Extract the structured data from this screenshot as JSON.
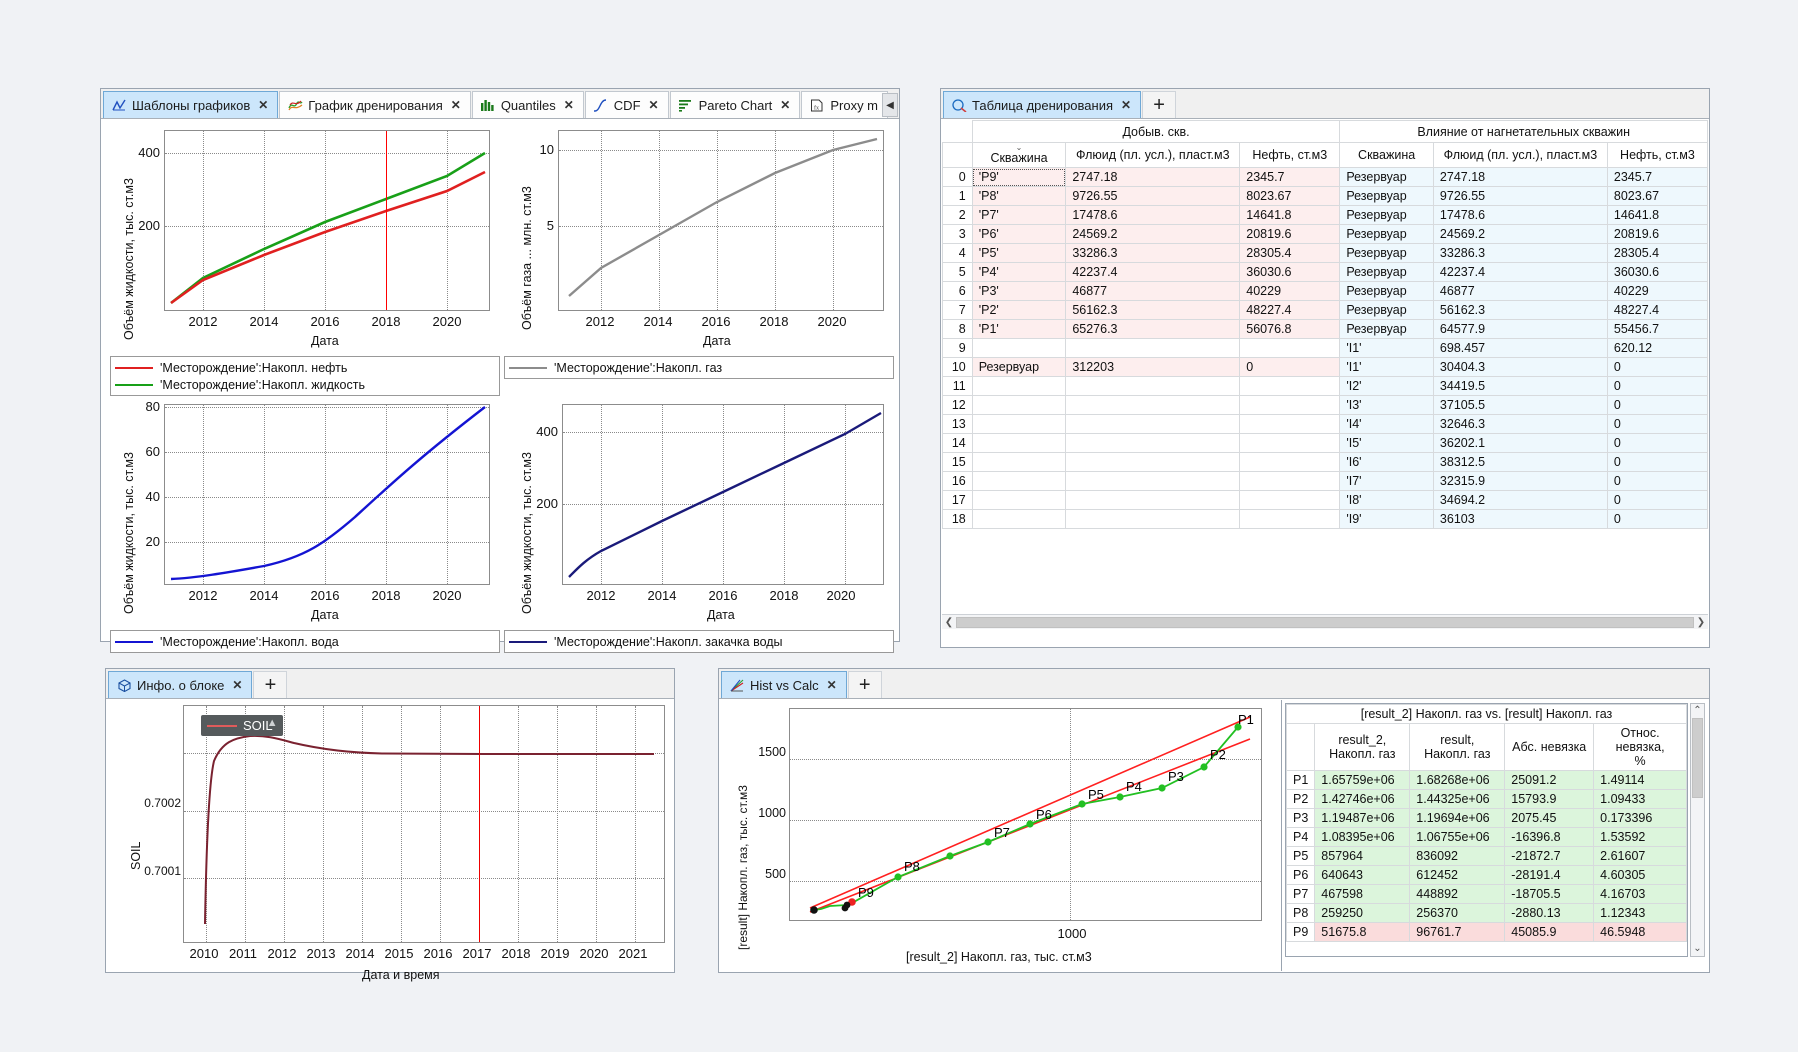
{
  "app": {
    "background": "#f0f2f5",
    "accent": "#cce6fb"
  },
  "panel_charts": {
    "tabs": [
      {
        "label": "Шаблоны графиков",
        "icon": "chart-curve-icon",
        "active": true,
        "close": "✕"
      },
      {
        "label": "График дренирования",
        "icon": "squiggle-icon",
        "active": false,
        "close": "✕"
      },
      {
        "label": "Quantiles",
        "icon": "histogram-icon",
        "active": false,
        "close": "✕"
      },
      {
        "label": "CDF",
        "icon": "cdf-curve-icon",
        "active": false,
        "close": "✕"
      },
      {
        "label": "Pareto Chart",
        "icon": "pareto-bars-icon",
        "active": false,
        "close": "✕"
      },
      {
        "label": "Proxy m",
        "icon": "formula-icon",
        "active": false,
        "close": ""
      }
    ],
    "scroll_right": "◀"
  },
  "chart_data": [
    {
      "id": "liquid-oil",
      "type": "line",
      "title": "",
      "xlabel": "Дата",
      "ylabel": "Объём жидкости, тыс. ст.м3",
      "xticks": [
        "2012",
        "2014",
        "2016",
        "2018",
        "2020"
      ],
      "yticks": [
        "200",
        "400"
      ],
      "ylim": [
        0,
        460
      ],
      "xlim": [
        2010.3,
        2021.0
      ],
      "grid": true,
      "cursor_x": 2017.75,
      "cursor_color": "#ff0000",
      "series": [
        {
          "name": "'Месторождение':Накопл. нефть",
          "color": "#e02020",
          "x": [
            2010.4,
            2012,
            2014,
            2016,
            2018,
            2020.8
          ],
          "values": [
            8,
            70,
            140,
            200,
            252,
            357
          ]
        },
        {
          "name": "'Месторождение':Накопл. жидкость",
          "color": "#18a018",
          "x": [
            2010.4,
            2012,
            2014,
            2016,
            2018,
            2020.8
          ],
          "values": [
            8,
            72,
            150,
            226,
            305,
            438
          ]
        }
      ],
      "legend_position": "bottom"
    },
    {
      "id": "gas",
      "type": "line",
      "xlabel": "Дата",
      "ylabel": "Объём газа ... млн. ст.м3",
      "xticks": [
        "2012",
        "2014",
        "2016",
        "2018",
        "2020"
      ],
      "yticks": [
        "5",
        "10"
      ],
      "ylim": [
        0,
        11.2
      ],
      "xlim": [
        2010.3,
        2021.0
      ],
      "grid": true,
      "series": [
        {
          "name": "'Месторождение':Накопл. газ",
          "color": "#8c8c8c",
          "x": [
            2010.4,
            2012,
            2014,
            2016,
            2018,
            2020.8
          ],
          "values": [
            0.6,
            2.6,
            4.4,
            6.4,
            8.2,
            10.7
          ]
        }
      ],
      "legend_position": "bottom"
    },
    {
      "id": "water",
      "type": "line",
      "xlabel": "Дата",
      "ylabel": "Объём жидкости, тыс. ст.м3",
      "xticks": [
        "2012",
        "2014",
        "2016",
        "2018",
        "2020"
      ],
      "yticks": [
        "20",
        "40",
        "60",
        "80"
      ],
      "ylim": [
        0,
        84
      ],
      "xlim": [
        2010.3,
        2021.0
      ],
      "grid": true,
      "series": [
        {
          "name": "'Месторождение':Накопл. вода",
          "color": "#1414d2",
          "x": [
            2010.4,
            2012,
            2014,
            2016,
            2018,
            2020.8
          ],
          "values": [
            1.5,
            4,
            10,
            22,
            42,
            81
          ]
        }
      ],
      "legend_position": "bottom"
    },
    {
      "id": "water-inj",
      "type": "line",
      "xlabel": "Дата",
      "ylabel": "Объём жидкости, тыс. ст.м3",
      "xticks": [
        "2012",
        "2014",
        "2016",
        "2018",
        "2020"
      ],
      "yticks": [
        "200",
        "400"
      ],
      "ylim": [
        0,
        500
      ],
      "xlim": [
        2010.3,
        2021.0
      ],
      "grid": true,
      "series": [
        {
          "name": "'Месторождение':Накопл. закачка воды",
          "color": "#1a1a7a",
          "x": [
            2010.4,
            2012,
            2014,
            2016,
            2018,
            2020.8
          ],
          "values": [
            8,
            100,
            190,
            280,
            370,
            480
          ]
        }
      ],
      "legend_position": "bottom"
    },
    {
      "id": "soil",
      "type": "line",
      "xlabel": "Дата и время",
      "ylabel": "SOIL",
      "xticks": [
        "2010",
        "2011",
        "2012",
        "2013",
        "2014",
        "2015",
        "2016",
        "2017",
        "2018",
        "2019",
        "2020",
        "2021"
      ],
      "yticks": [
        "0.7001",
        "0.7002"
      ],
      "grid": true,
      "cursor_x": 2017.75,
      "cursor_color": "#ff0000",
      "legend_overlay": "SOIL",
      "series": [
        {
          "name": "SOIL",
          "color": "#7a2230",
          "x": [
            2010.0,
            2010.1,
            2010.25,
            2010.5,
            2011.0,
            2011.5,
            2012.0,
            2013.0,
            2014.0,
            2015.0,
            2017.0,
            2019.0,
            2021.0
          ],
          "values": [
            0.7,
            0.70015,
            0.70025,
            0.70029,
            0.70031,
            0.700315,
            0.70031,
            0.700305,
            0.7003,
            0.700298,
            0.700297,
            0.700297,
            0.700297
          ]
        }
      ]
    },
    {
      "id": "hist-vs-calc",
      "type": "scatter",
      "xlabel": "[result_2] Накопл. газ, тыс. ст.м3",
      "ylabel": "[result] Накопл. газ, тыс. ст.м3",
      "xticks": [
        "1000"
      ],
      "yticks": [
        "500",
        "1000",
        "1500"
      ],
      "grid": true,
      "points": [
        {
          "label": "P1",
          "x": 1657.59,
          "y": 1682.68
        },
        {
          "label": "P2",
          "x": 1427.46,
          "y": 1443.25
        },
        {
          "label": "P3",
          "x": 1194.87,
          "y": 1196.94
        },
        {
          "label": "P4",
          "x": 1083.95,
          "y": 1067.55
        },
        {
          "label": "P5",
          "x": 857.96,
          "y": 836.09
        },
        {
          "label": "P6",
          "x": 640.64,
          "y": 612.45
        },
        {
          "label": "P7",
          "x": 467.6,
          "y": 448.89
        },
        {
          "label": "P8",
          "x": 259.25,
          "y": 256.37
        },
        {
          "label": "P9",
          "x": 51.68,
          "y": 96.76
        }
      ],
      "point_color": "#22c022",
      "tolerance_lines_color": "#ff2020"
    }
  ],
  "panel_drainage_table": {
    "tabs": [
      {
        "label": "Таблица дренирования",
        "icon": "table-icon",
        "active": true,
        "close": "✕"
      }
    ],
    "add_tab": "✛",
    "group_headers": [
      "",
      "Добыв. скв.",
      "Влияние от нагнетательных скважин"
    ],
    "columns": [
      "",
      "Скважина",
      "Флюид (пл. усл.), пласт.м3",
      "Нефть, ст.м3",
      "Скважина",
      "Флюид (пл. усл.), пласт.м3",
      "Нефть, ст.м3"
    ],
    "sort_icon": "chevron-down-icon",
    "rows": [
      [
        "0",
        "'P9'",
        "2747.18",
        "2345.7",
        "Резервуар",
        "2747.18",
        "2345.7"
      ],
      [
        "1",
        "'P8'",
        "9726.55",
        "8023.67",
        "Резервуар",
        "9726.55",
        "8023.67"
      ],
      [
        "2",
        "'P7'",
        "17478.6",
        "14641.8",
        "Резервуар",
        "17478.6",
        "14641.8"
      ],
      [
        "3",
        "'P6'",
        "24569.2",
        "20819.6",
        "Резервуар",
        "24569.2",
        "20819.6"
      ],
      [
        "4",
        "'P5'",
        "33286.3",
        "28305.4",
        "Резервуар",
        "33286.3",
        "28305.4"
      ],
      [
        "5",
        "'P4'",
        "42237.4",
        "36030.6",
        "Резервуар",
        "42237.4",
        "36030.6"
      ],
      [
        "6",
        "'P3'",
        "46877",
        "40229",
        "Резервуар",
        "46877",
        "40229"
      ],
      [
        "7",
        "'P2'",
        "56162.3",
        "48227.4",
        "Резервуар",
        "56162.3",
        "48227.4"
      ],
      [
        "8",
        "'P1'",
        "65276.3",
        "56076.8",
        "Резервуар",
        "64577.9",
        "55456.7"
      ],
      [
        "9",
        "",
        "",
        "",
        "'I1'",
        "698.457",
        "620.12"
      ],
      [
        "10",
        "Резервуар",
        "312203",
        "0",
        "'I1'",
        "30404.3",
        "0"
      ],
      [
        "11",
        "",
        "",
        "",
        "'I2'",
        "34419.5",
        "0"
      ],
      [
        "12",
        "",
        "",
        "",
        "'I3'",
        "37105.5",
        "0"
      ],
      [
        "13",
        "",
        "",
        "",
        "'I4'",
        "32646.3",
        "0"
      ],
      [
        "14",
        "",
        "",
        "",
        "'I5'",
        "36202.1",
        "0"
      ],
      [
        "15",
        "",
        "",
        "",
        "'I6'",
        "38312.5",
        "0"
      ],
      [
        "16",
        "",
        "",
        "",
        "'I7'",
        "32315.9",
        "0"
      ],
      [
        "17",
        "",
        "",
        "",
        "'I8'",
        "34694.2",
        "0"
      ],
      [
        "18",
        "",
        "",
        "",
        "'I9'",
        "36103",
        "0"
      ]
    ],
    "hscroll": {
      "left_arrow": "❮",
      "right_arrow": "❯"
    }
  },
  "panel_block_info": {
    "tabs": [
      {
        "label": "Инфо. о блоке",
        "icon": "cube-icon",
        "active": true,
        "close": "✕"
      }
    ],
    "add_tab": "✛"
  },
  "panel_hist_calc": {
    "tabs": [
      {
        "label": "Hist vs Calc",
        "icon": "scatter-icon",
        "active": true,
        "close": "✕"
      }
    ],
    "add_tab": "✛",
    "comparison_table": {
      "title": "[result_2] Накопл. газ vs. [result] Накопл. газ",
      "columns": [
        "result_2,\nНакопл. газ",
        "result,\nНакопл. газ",
        "Абс. невязка",
        "Относ. невязка,\n%"
      ],
      "rows": [
        {
          "id": "P1",
          "result_2": "1.65759e+06",
          "result": "1.68268e+06",
          "abs": "25091.2",
          "rel": "1.49114",
          "status": "ok"
        },
        {
          "id": "P2",
          "result_2": "1.42746e+06",
          "result": "1.44325e+06",
          "abs": "15793.9",
          "rel": "1.09433",
          "status": "ok"
        },
        {
          "id": "P3",
          "result_2": "1.19487e+06",
          "result": "1.19694e+06",
          "abs": "2075.45",
          "rel": "0.173396",
          "status": "ok"
        },
        {
          "id": "P4",
          "result_2": "1.08395e+06",
          "result": "1.06755e+06",
          "abs": "-16396.8",
          "rel": "1.53592",
          "status": "ok"
        },
        {
          "id": "P5",
          "result_2": "857964",
          "result": "836092",
          "abs": "-21872.7",
          "rel": "2.61607",
          "status": "ok"
        },
        {
          "id": "P6",
          "result_2": "640643",
          "result": "612452",
          "abs": "-28191.4",
          "rel": "4.60305",
          "status": "ok"
        },
        {
          "id": "P7",
          "result_2": "467598",
          "result": "448892",
          "abs": "-18705.5",
          "rel": "4.16703",
          "status": "ok"
        },
        {
          "id": "P8",
          "result_2": "259250",
          "result": "256370",
          "abs": "-2880.13",
          "rel": "1.12343",
          "status": "ok"
        },
        {
          "id": "P9",
          "result_2": "51675.8",
          "result": "96761.7",
          "abs": "45085.9",
          "rel": "46.5948",
          "status": "bad"
        }
      ],
      "vscroll": {
        "up": "⌃",
        "down": "⌄"
      }
    }
  }
}
